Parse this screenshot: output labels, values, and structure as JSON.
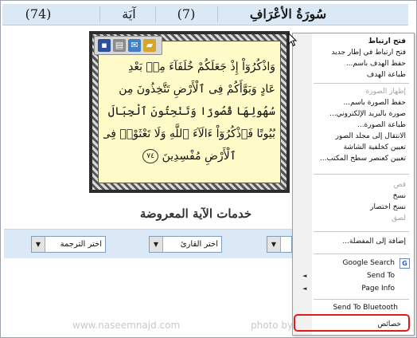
{
  "header": {
    "surah_title": "سُورَةُ الأعْرَافِ",
    "surah_number": "(7)",
    "ayah_label": "آيَة",
    "ayah_number": "(74)"
  },
  "verse": {
    "lines": [
      "وَاذْكُرُوٓاْ إِذْ جَعَلَكُمْ خُلَفَآءَ مِنۢ بَعْدِ",
      "عَادٍ وَبَوَّأَكُمْ فِى ٱلْأَرْضِ تَتَّخِذُونَ مِن",
      "سُهُولِهَا قُصُورًا وَتَنْحِتُونَ ٱلْجِبَالَ",
      "بُيُوتًا فَٱذْكُرُوٓاْ ءَالَآءَ ٱللَّهِ وَلَا تَعْثَوْا۟ فِى",
      "ٱلْأَرْضِ مُفْسِدِينَ"
    ],
    "ayah_marker": "٧٤"
  },
  "image_toolbar": {
    "icons": [
      "save-icon",
      "print-icon",
      "email-icon",
      "folder-icon"
    ]
  },
  "services": {
    "title": "خدمات الآية المعروضة",
    "select_reader": "اختر القارئ",
    "select_translation": "اختر الترجمة"
  },
  "watermark": {
    "left": "www.naseemnajd.com",
    "right": "photo by :naseemnajd"
  },
  "context_menu": {
    "items": [
      {
        "label": "فتح ارتباط",
        "enabled": true
      },
      {
        "label": "فتح ارتباط في إطار جديد",
        "enabled": true
      },
      {
        "label": "حفظ الهدف باسم...",
        "enabled": true
      },
      {
        "label": "طباعة الهدف",
        "enabled": true
      },
      {
        "label": "إظهار الصورة",
        "enabled": false
      },
      {
        "label": "حفظ الصورة باسم...",
        "enabled": true
      },
      {
        "label": "صورة بالبريد الإلكتروني...",
        "enabled": true
      },
      {
        "label": "طباعة الصورة...",
        "enabled": true
      },
      {
        "label": "الانتقال إلى مجلد الصور",
        "enabled": true
      },
      {
        "label": "تعيين كخلفية الشاشة",
        "enabled": true
      },
      {
        "label": "تعيين كعنصر سطح المكتب...",
        "enabled": true
      },
      {
        "label": "قص",
        "enabled": false
      },
      {
        "label": "نسخ",
        "enabled": true
      },
      {
        "label": "نسخ اختصار",
        "enabled": true
      },
      {
        "label": "لصق",
        "enabled": false
      },
      {
        "label": "إضافة إلى المفضلة...",
        "enabled": true
      },
      {
        "label": "Google Search",
        "enabled": true
      },
      {
        "label": "Send To",
        "enabled": true
      },
      {
        "label": "Page Info",
        "enabled": true
      },
      {
        "label": "Send To Bluetooth",
        "enabled": true
      },
      {
        "label": "خصائص",
        "enabled": true
      }
    ]
  },
  "colors": {
    "accent": "#dbe8f6",
    "highlight": "#e01b1b",
    "paper": "#fffbc9"
  }
}
